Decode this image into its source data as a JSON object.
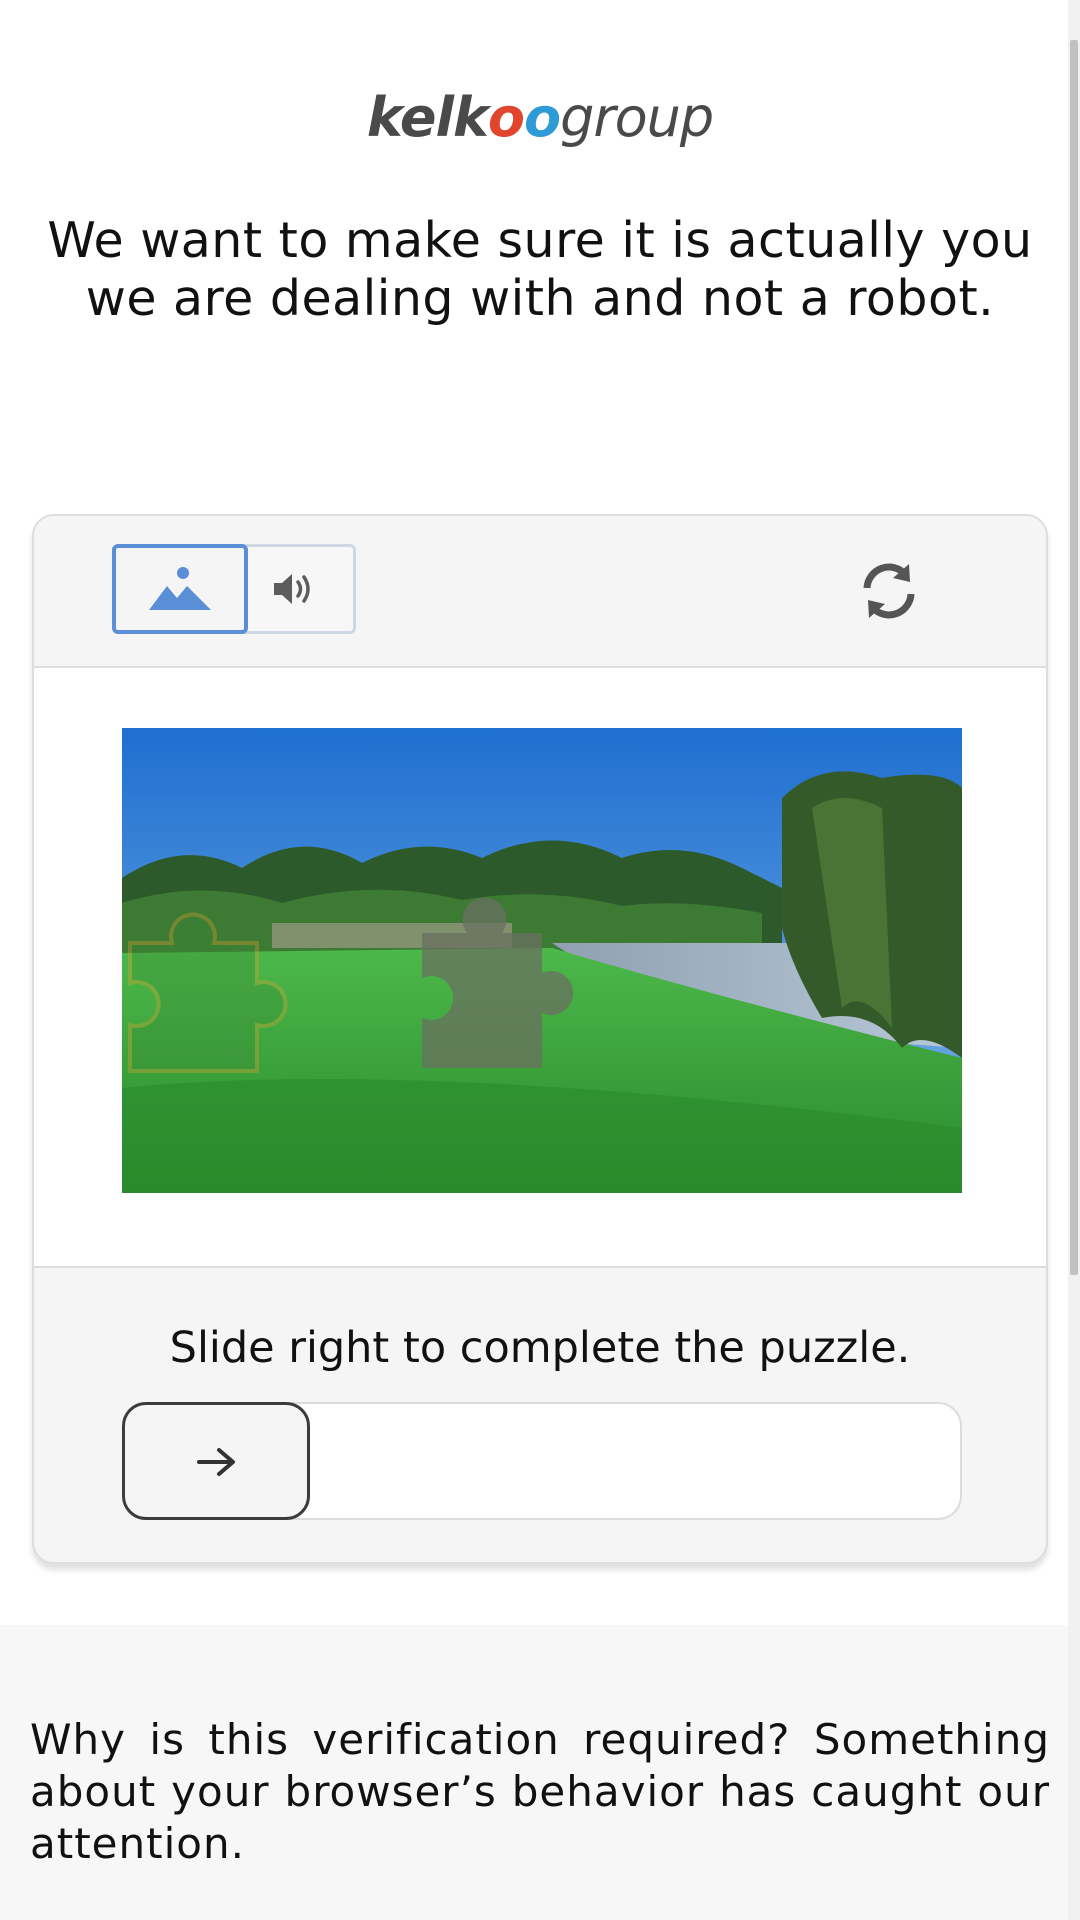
{
  "logo": {
    "kelk": "kelk",
    "o1": "o",
    "o2": "o",
    "group": "group"
  },
  "headline": "We want to make sure it is actually you we are dealing with and not a robot.",
  "captcha": {
    "modes": [
      {
        "name": "image",
        "icon": "image-icon",
        "selected": true
      },
      {
        "name": "audio",
        "icon": "speaker-icon",
        "selected": false
      }
    ],
    "refresh_icon": "refresh-icon",
    "instruction": "Slide right to complete the puzzle.",
    "slider_icon": "arrow-right-icon",
    "slider_progress": 0
  },
  "explanation": "Why is this verification required? Something about your browser’s behavior has caught our attention.",
  "colors": {
    "selected_border": "#5a8fd8",
    "puzzle_outline": "#e0a030",
    "sky": "#2f7fd6",
    "grass": "#2fa03a"
  }
}
